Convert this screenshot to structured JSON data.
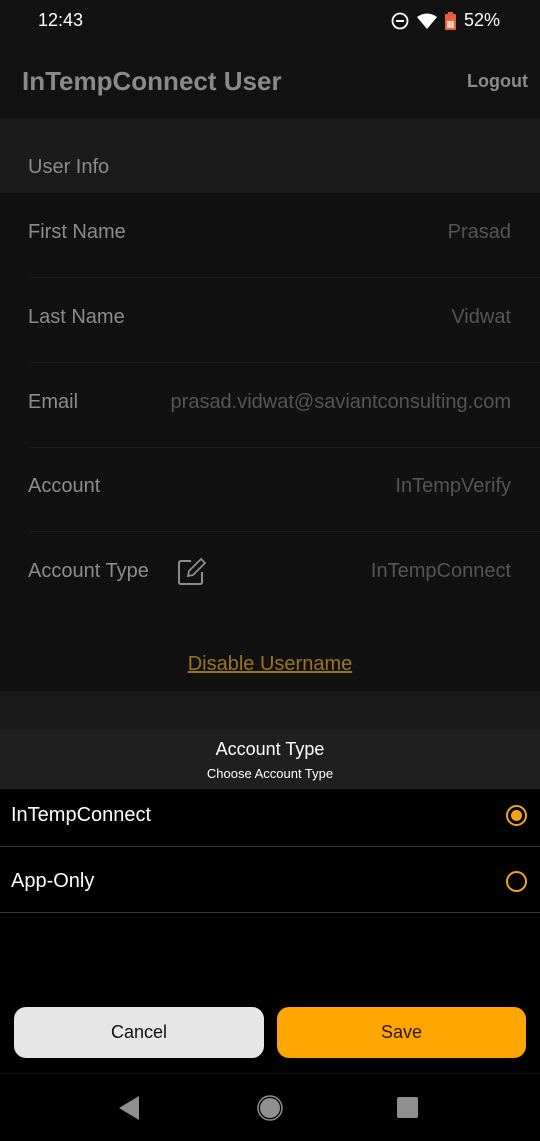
{
  "status_bar": {
    "time": "12:43",
    "battery": "52%"
  },
  "app_bar": {
    "title": "InTempConnect User",
    "logout_label": "Logout"
  },
  "section": {
    "title": "User Info"
  },
  "fields": [
    {
      "label": "First Name",
      "value": "Prasad"
    },
    {
      "label": "Last Name",
      "value": "Vidwat"
    },
    {
      "label": "Email",
      "value": "prasad.vidwat@saviantconsulting.com"
    },
    {
      "label": "Account",
      "value": "InTempVerify"
    },
    {
      "label": "Account Type",
      "value": "InTempConnect"
    }
  ],
  "disable_link": "Disable Username",
  "sheet": {
    "title": "Account Type",
    "subtitle": "Choose Account Type",
    "options": [
      {
        "label": "InTempConnect",
        "selected": true
      },
      {
        "label": "App-Only",
        "selected": false
      }
    ],
    "cancel_label": "Cancel",
    "save_label": "Save"
  },
  "colors": {
    "accent": "#ffa600",
    "link": "#9b7420"
  }
}
